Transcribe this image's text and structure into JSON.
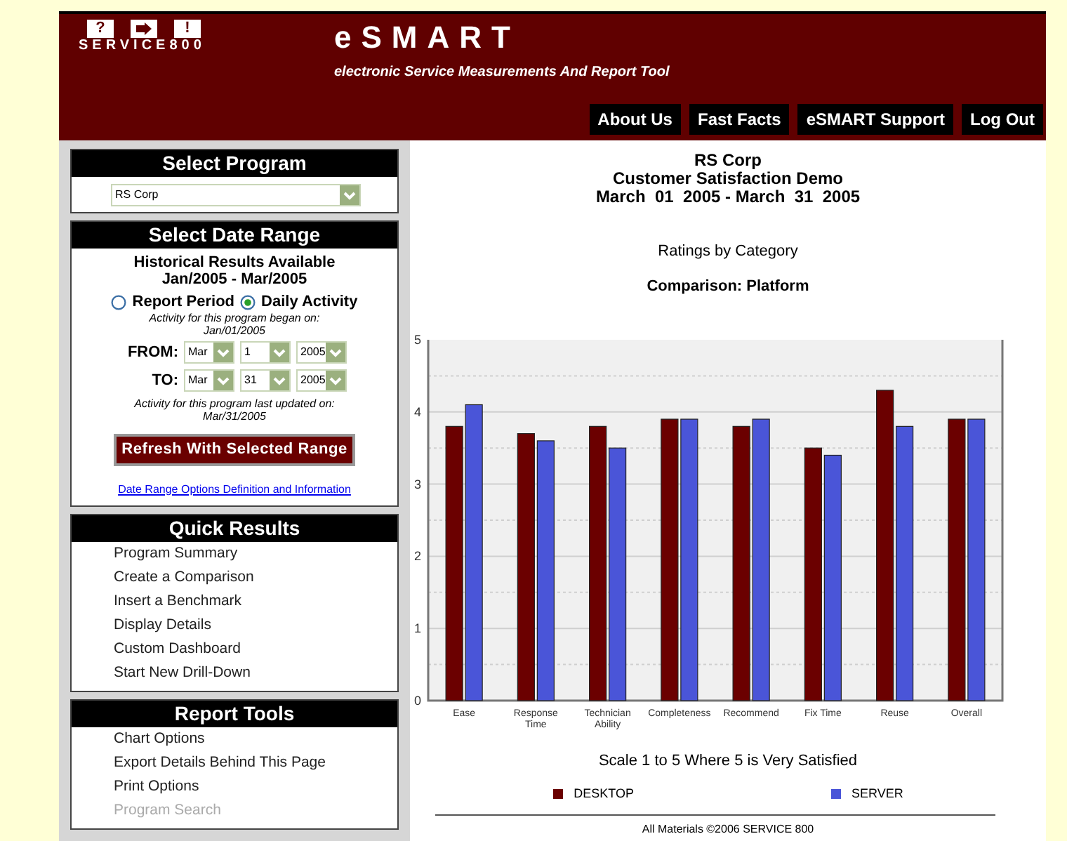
{
  "logo": {
    "keys": [
      "?",
      "!"
    ],
    "wordmark": "SERVICE800"
  },
  "header": {
    "title": "eSMART",
    "subtitle": "electronic Service Measurements And Report Tool"
  },
  "nav": [
    "About Us",
    "Fast Facts",
    "eSMART Support",
    "Log Out"
  ],
  "program_panel": {
    "title": "Select Program",
    "program": "RS Corp"
  },
  "date_panel": {
    "title": "Select Date Range",
    "available": "Historical Results Available",
    "available_range": "Jan/2005 - Mar/2005",
    "modes": [
      {
        "label": "Report Period",
        "selected": false
      },
      {
        "label": "Daily Activity",
        "selected": true
      }
    ],
    "began_note": "Activity for this program began on:",
    "began_date": "Jan/01/2005",
    "from": {
      "label": "FROM:",
      "month": "Mar",
      "day": "1",
      "year": "2005"
    },
    "to": {
      "label": "TO:",
      "month": "Mar",
      "day": "31",
      "year": "2005"
    },
    "updated_note": "Activity for this program last updated on:",
    "updated_date": "Mar/31/2005",
    "refresh_button": "Refresh With Selected Range",
    "info_link": "Date Range Options Definition and Information"
  },
  "quick_results": {
    "title": "Quick Results",
    "items": [
      {
        "label": "Program Summary",
        "disabled": false
      },
      {
        "label": "Create a Comparison",
        "disabled": false
      },
      {
        "label": "Insert a Benchmark",
        "disabled": false
      },
      {
        "label": "Display Details",
        "disabled": false
      },
      {
        "label": "Custom Dashboard",
        "disabled": false
      },
      {
        "label": "Start New Drill-Down",
        "disabled": false
      }
    ]
  },
  "report_tools": {
    "title": "Report Tools",
    "items": [
      {
        "label": "Chart Options",
        "disabled": false
      },
      {
        "label": "Export Details Behind This Page",
        "disabled": false
      },
      {
        "label": "Print Options",
        "disabled": false
      },
      {
        "label": "Program Search",
        "disabled": true
      }
    ]
  },
  "report": {
    "heading": [
      "RS Corp",
      "Customer Satisfaction Demo",
      "March  01  2005 - March  31  2005"
    ],
    "chart_title": "Ratings by Category",
    "chart_subtitle": "Comparison: Platform",
    "chart_data": {
      "type": "bar",
      "categories": [
        "Ease",
        "Response\nTime",
        "Technician\nAbility",
        "Completeness",
        "Recommend",
        "Fix Time",
        "Reuse",
        "Overall"
      ],
      "series": [
        {
          "name": "DESKTOP",
          "color": "#6b0000",
          "values": [
            3.8,
            3.7,
            3.8,
            3.9,
            3.8,
            3.5,
            4.3,
            3.9
          ]
        },
        {
          "name": "SERVER",
          "color": "#4a55d8",
          "values": [
            4.1,
            3.6,
            3.5,
            3.9,
            3.9,
            3.4,
            3.8,
            3.9
          ]
        }
      ],
      "grid": true,
      "ylim": [
        0,
        5
      ],
      "yticks": [
        0,
        1,
        2,
        3,
        4,
        5
      ]
    },
    "scale_note": "Scale 1 to 5 Where 5 is Very Satisfied",
    "footer": "All Materials ©2006 SERVICE 800"
  }
}
